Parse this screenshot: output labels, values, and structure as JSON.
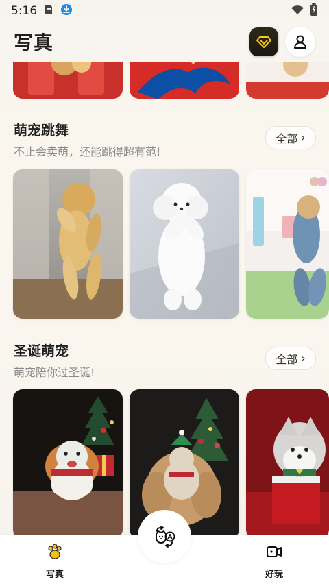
{
  "status_bar": {
    "time": "5:16"
  },
  "header": {
    "title": "写真"
  },
  "sections": [
    {
      "title": "萌宠跳舞",
      "subtitle": "不止会卖萌，还能跳得超有范!",
      "all_label": "全部"
    },
    {
      "title": "圣诞萌宠",
      "subtitle": "萌宠陪你过圣诞!",
      "all_label": "全部"
    }
  ],
  "bottom_nav": {
    "items": [
      {
        "label": "写真"
      },
      {
        "label": "好玩"
      }
    ]
  },
  "icons": {
    "battery": "battery-icon",
    "wifi": "wifi-icon",
    "download": "download-icon",
    "vip": "vip-icon",
    "profile": "profile-icon",
    "paw": "paw-icon",
    "video": "video-icon",
    "pet_switch": "pet-switch-icon"
  },
  "colors": {
    "background": "#f7f4ee",
    "accent_gold": "#f3c621",
    "text_primary": "#1f1f1f",
    "text_secondary": "#8a8a8a"
  }
}
